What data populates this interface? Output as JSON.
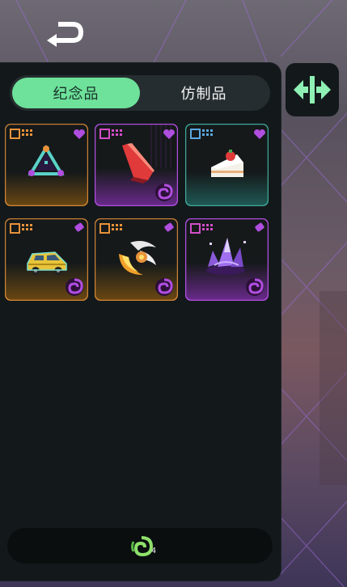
{
  "tabs": [
    {
      "label": "纪念品",
      "active": true
    },
    {
      "label": "仿制品",
      "active": false
    }
  ],
  "colors": {
    "accent": "#6ee29a",
    "orange": "#e8923a",
    "purple": "#b04ee0",
    "teal": "#3fa89a",
    "panel": "#13191b"
  },
  "items": [
    {
      "tier_color": "orange",
      "corner_icon": "heart-icon",
      "art": "triangle-relic-icon",
      "has_swirl": false
    },
    {
      "tier_color": "purple",
      "corner_icon": "heart-icon",
      "art": "red-blade-icon",
      "has_swirl": true
    },
    {
      "tier_color": "teal",
      "corner_icon": "heart-icon",
      "art": "strawberry-cake-icon",
      "has_swirl": false
    },
    {
      "tier_color": "orange",
      "corner_icon": "eraser-icon",
      "art": "yellow-car-icon",
      "has_swirl": true
    },
    {
      "tier_color": "orange",
      "corner_icon": "eraser-icon",
      "art": "fire-crescent-icon",
      "has_swirl": true
    },
    {
      "tier_color": "purple",
      "corner_icon": "eraser-icon",
      "art": "purple-crystal-icon",
      "has_swirl": true
    }
  ],
  "bottom": {
    "count": "4",
    "icon": "green-swirl-icon"
  }
}
